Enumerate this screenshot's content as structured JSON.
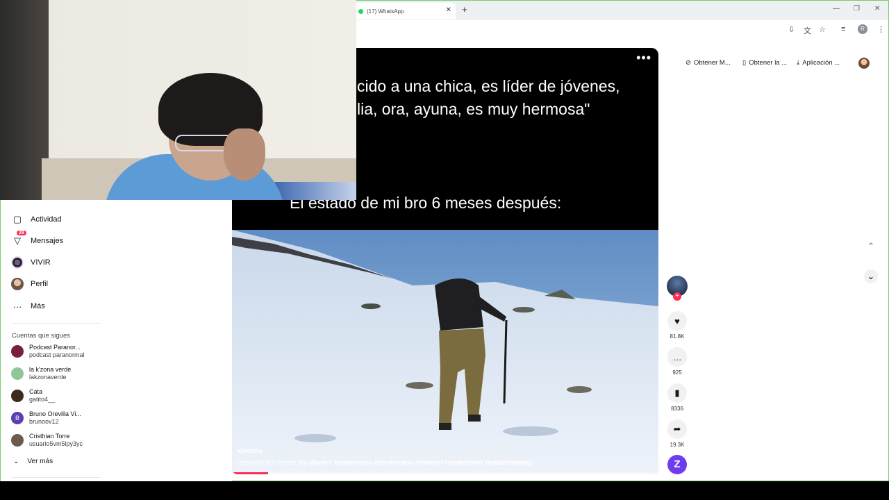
{
  "browser": {
    "tab_title": "(17) WhatsApp",
    "tab_close": "✕",
    "new_tab": "+",
    "window_controls": [
      "—",
      "❐",
      "✕"
    ],
    "profile_initial": "R"
  },
  "header_links": [
    {
      "icon": "compass-icon",
      "glyph": "⊘",
      "label": "Obtener M..."
    },
    {
      "icon": "phone-icon",
      "glyph": "▯",
      "label": "Obtener la ..."
    },
    {
      "icon": "download-icon",
      "glyph": "⤓",
      "label": "Aplicación ..."
    }
  ],
  "sidebar": {
    "items": [
      {
        "name": "actividad",
        "icon": "activity-icon",
        "glyph": "▢",
        "label": "Actividad"
      },
      {
        "name": "mensajes",
        "icon": "messages-icon",
        "glyph": "▽",
        "label": "Mensajes",
        "badge": "29"
      },
      {
        "name": "vivir",
        "icon": "live-avatar",
        "glyph": "",
        "label": "VIVIR"
      },
      {
        "name": "perfil",
        "icon": "profile-avatar",
        "glyph": "",
        "label": "Perfil"
      },
      {
        "name": "mas",
        "icon": "more-icon",
        "glyph": "···",
        "label": "Más"
      }
    ],
    "following_title": "Cuentas que sigues",
    "following": [
      {
        "name": "Podcast Paranor...",
        "user": "podcast paranormal",
        "color": "#7a1f3b"
      },
      {
        "name": "la k'zona verde",
        "user": "lakzonaverde",
        "color": "#8fc79a"
      },
      {
        "name": "Cata",
        "user": "gatito4__",
        "color": "#3b2a1e"
      },
      {
        "name": "Bruno Orevilla Vi...",
        "user": "brunoov12",
        "color": "#5b3fb0",
        "initial": "B"
      },
      {
        "name": "Cristhian Torre",
        "user": "usuario5vm5lpy3yc",
        "color": "#6d5a4c"
      }
    ],
    "see_more": "Ver más"
  },
  "video": {
    "caption_line1": "cido a una chica, es líder de jóvenes,",
    "caption_line2": "lia, ora, ayuna, es muy hermosa\"",
    "caption_line3": "El estado de mi bro 6 meses después:",
    "username": "xinozina",
    "description": "Jajsksksksk 6 meses dsp",
    "hashtags": [
      "#humor",
      "#senderismo",
      "#senderismo",
      "#invernal",
      "#senderismo",
      "#vidadetrekking"
    ],
    "progress": 0.085
  },
  "actions": {
    "likes": "81.8K",
    "comments": "925",
    "saves": "8336",
    "shares": "19.3K"
  },
  "colors": {
    "accent": "#fe2c55",
    "brand_purple": "#6f3cf0",
    "whatsapp": "#25d366"
  }
}
